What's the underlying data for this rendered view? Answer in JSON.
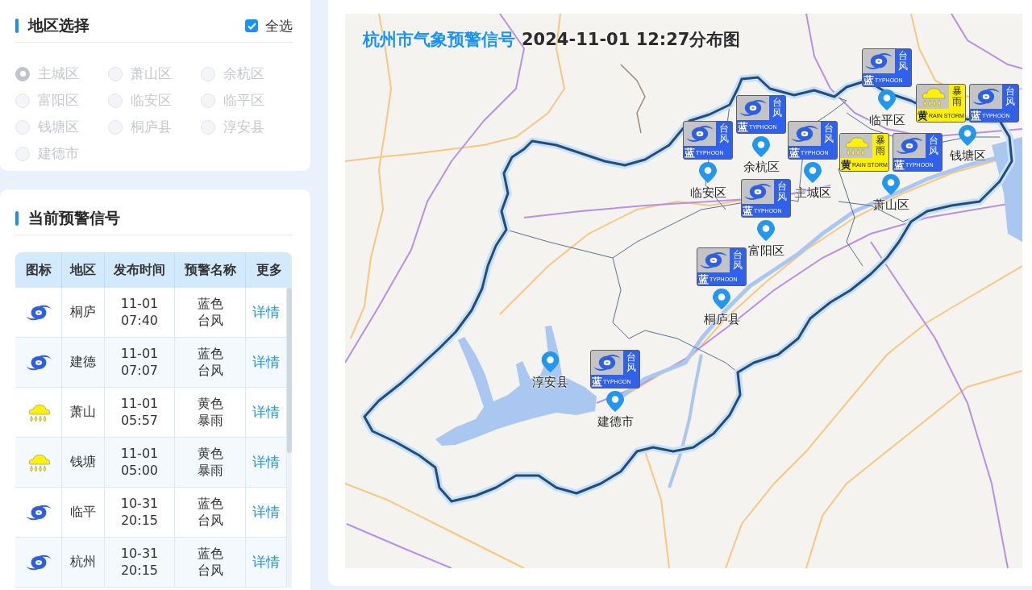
{
  "region_panel": {
    "title": "地区选择",
    "select_all": {
      "label": "全选",
      "checked": true
    },
    "regions": [
      {
        "label": "主城区",
        "selected": true,
        "disabled": true
      },
      {
        "label": "萧山区",
        "selected": false,
        "disabled": true
      },
      {
        "label": "余杭区",
        "selected": false,
        "disabled": true
      },
      {
        "label": "富阳区",
        "selected": false,
        "disabled": true
      },
      {
        "label": "临安区",
        "selected": false,
        "disabled": true
      },
      {
        "label": "临平区",
        "selected": false,
        "disabled": true
      },
      {
        "label": "钱塘区",
        "selected": false,
        "disabled": true
      },
      {
        "label": "桐庐县",
        "selected": false,
        "disabled": true
      },
      {
        "label": "淳安县",
        "selected": false,
        "disabled": true
      },
      {
        "label": "建德市",
        "selected": false,
        "disabled": true
      }
    ]
  },
  "warning_panel": {
    "title": "当前预警信号",
    "table": {
      "columns": [
        "图标",
        "地区",
        "发布时间",
        "预警名称",
        "更多"
      ],
      "rows": [
        {
          "kind": "typhoon",
          "region": "桐庐",
          "time": "11-01 07:40",
          "name": "蓝色台风",
          "action": "详情"
        },
        {
          "kind": "typhoon",
          "region": "建德",
          "time": "11-01 07:07",
          "name": "蓝色台风",
          "action": "详情"
        },
        {
          "kind": "rainstorm",
          "region": "萧山",
          "time": "11-01 05:57",
          "name": "黄色暴雨",
          "action": "详情"
        },
        {
          "kind": "rainstorm",
          "region": "钱塘",
          "time": "11-01 05:00",
          "name": "黄色暴雨",
          "action": "详情"
        },
        {
          "kind": "typhoon",
          "region": "临平",
          "time": "10-31 20:15",
          "name": "蓝色台风",
          "action": "详情"
        },
        {
          "kind": "typhoon",
          "region": "杭州",
          "time": "10-31 20:15",
          "name": "蓝色台风",
          "action": "详情"
        }
      ]
    }
  },
  "map": {
    "title": "杭州市气象预警信号",
    "subtitle": "2024-11-01 12:27分布图",
    "markers": [
      {
        "label": "临平区",
        "signals": [
          {
            "kind": "typhoon",
            "name": "台风",
            "level": "蓝",
            "english": "TYPHOON"
          }
        ]
      },
      {
        "label": "钱塘区",
        "signals": [
          {
            "kind": "rainstorm",
            "name": "暴雨",
            "level": "黄",
            "english": "RAIN STORM"
          },
          {
            "kind": "typhoon",
            "name": "台风",
            "level": "蓝",
            "english": "TYPHOON"
          }
        ]
      },
      {
        "label": "余杭区",
        "signals": [
          {
            "kind": "typhoon",
            "name": "台风",
            "level": "蓝",
            "english": "TYPHOON"
          }
        ]
      },
      {
        "label": "临安区",
        "signals": [
          {
            "kind": "typhoon",
            "name": "台风",
            "level": "蓝",
            "english": "TYPHOON"
          }
        ]
      },
      {
        "label": "主城区",
        "signals": [
          {
            "kind": "typhoon",
            "name": "台风",
            "level": "蓝",
            "english": "TYPHOON"
          }
        ]
      },
      {
        "label": "萧山区",
        "signals": [
          {
            "kind": "rainstorm",
            "name": "暴雨",
            "level": "黄",
            "english": "RAIN STORM"
          },
          {
            "kind": "typhoon",
            "name": "台风",
            "level": "蓝",
            "english": "TYPHOON"
          }
        ]
      },
      {
        "label": "富阳区",
        "signals": [
          {
            "kind": "typhoon",
            "name": "台风",
            "level": "蓝",
            "english": "TYPHOON"
          }
        ]
      },
      {
        "label": "桐庐县",
        "signals": [
          {
            "kind": "typhoon",
            "name": "台风",
            "level": "蓝",
            "english": "TYPHOON"
          }
        ]
      },
      {
        "label": "淳安县"
      },
      {
        "label": "建德市",
        "signals": [
          {
            "kind": "typhoon",
            "name": "台风",
            "level": "蓝",
            "english": "TYPHOON"
          }
        ]
      }
    ]
  }
}
